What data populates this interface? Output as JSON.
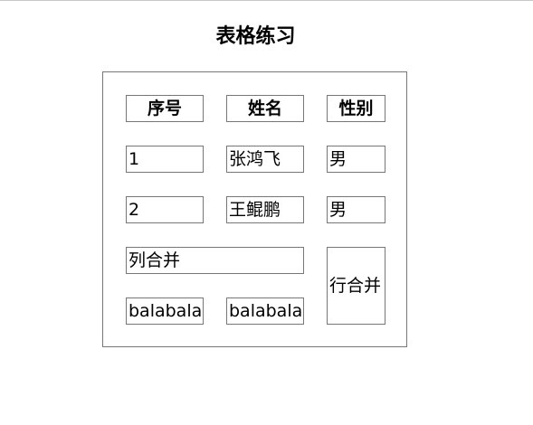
{
  "page": {
    "title": "表格练习"
  },
  "table": {
    "headers": [
      "序号",
      "姓名",
      "性别"
    ],
    "rows": [
      [
        "1",
        "张鸿飞",
        "男"
      ],
      [
        "2",
        "王鲲鹏",
        "男"
      ]
    ],
    "colspan_cell": "列合并",
    "rowspan_cell": "行合并",
    "last_row": [
      "balabala",
      "balabala"
    ]
  }
}
